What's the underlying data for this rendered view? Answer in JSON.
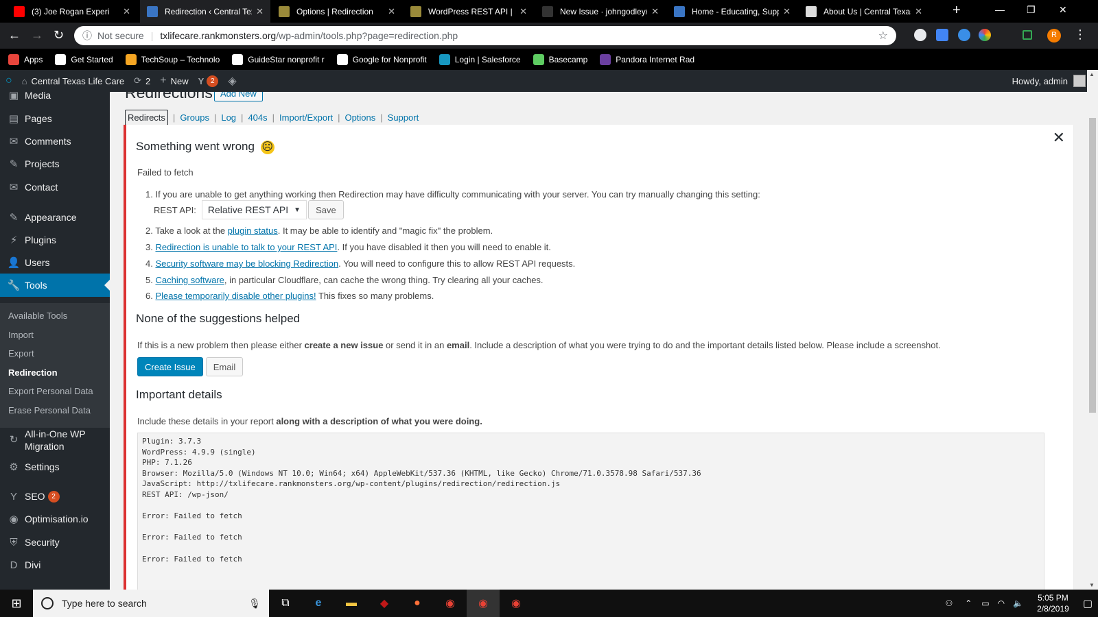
{
  "browser": {
    "tabs": [
      {
        "title": "(3) Joe Rogan Experi",
        "favicon": "youtube-icon",
        "color": "#ff0000"
      },
      {
        "title": "Redirection ‹ Central Tex",
        "favicon": "wp-site-icon",
        "color": "#3a75c4",
        "active": true
      },
      {
        "title": "Options | Redirection",
        "favicon": "plugin-icon",
        "color": "#9a8a3a"
      },
      {
        "title": "WordPress REST API | Re",
        "favicon": "plugin-icon",
        "color": "#9a8a3a"
      },
      {
        "title": "New Issue · johngodley/",
        "favicon": "github-icon",
        "color": "#333333"
      },
      {
        "title": "Home - Educating, Supp",
        "favicon": "wp-site-icon",
        "color": "#3a75c4"
      },
      {
        "title": "About Us | Central Texas",
        "favicon": "page-icon",
        "color": "#dddddd"
      }
    ],
    "url": {
      "security": "Not secure",
      "host": "txlifecare.rankmonsters.org",
      "path": "/wp-admin/tools.php?page=redirection.php"
    },
    "bookmarks": [
      {
        "label": "Apps",
        "icon": "apps-icon",
        "color": "#e8453c"
      },
      {
        "label": "Get Started",
        "icon": "google-icon",
        "color": "#ffffff"
      },
      {
        "label": "TechSoup – Technolo",
        "icon": "techsoup-icon",
        "color": "#f5a623"
      },
      {
        "label": "GuideStar nonprofit r",
        "icon": "guidestar-icon",
        "color": "#ffffff"
      },
      {
        "label": "Google for Nonprofit",
        "icon": "google-icon",
        "color": "#ffffff"
      },
      {
        "label": "Login | Salesforce",
        "icon": "salesforce-icon",
        "color": "#1798c1"
      },
      {
        "label": "Basecamp",
        "icon": "basecamp-icon",
        "color": "#5ecc62"
      },
      {
        "label": "Pandora Internet Rad",
        "icon": "pandora-icon",
        "color": "#6b3fa0"
      }
    ],
    "profile_initial": "R"
  },
  "adminbar": {
    "site_name": "Central Texas Life Care",
    "updates_count": "2",
    "new_label": "New",
    "seo_badge": "2",
    "howdy": "Howdy, admin"
  },
  "sidebar": {
    "items": [
      {
        "label": "Media",
        "icon": "media-icon",
        "top": 0
      },
      {
        "label": "Pages",
        "icon": "pages-icon"
      },
      {
        "label": "Comments",
        "icon": "comments-icon"
      },
      {
        "label": "Projects",
        "icon": "projects-icon"
      },
      {
        "label": "Contact",
        "icon": "contact-icon"
      },
      {
        "label": "Appearance",
        "icon": "appearance-icon"
      },
      {
        "label": "Plugins",
        "icon": "plugins-icon"
      },
      {
        "label": "Users",
        "icon": "users-icon"
      },
      {
        "label": "Tools",
        "icon": "tools-icon",
        "current": true
      },
      {
        "label": "All-in-One WP Migration",
        "icon": "migration-icon"
      },
      {
        "label": "Settings",
        "icon": "settings-icon"
      },
      {
        "label": "SEO",
        "icon": "seo-icon",
        "badge": "2"
      },
      {
        "label": "Optimisation.io",
        "icon": "optimisation-icon"
      },
      {
        "label": "Security",
        "icon": "security-icon"
      },
      {
        "label": "Divi",
        "icon": "divi-icon"
      }
    ],
    "submenu": [
      {
        "label": "Available Tools"
      },
      {
        "label": "Import"
      },
      {
        "label": "Export"
      },
      {
        "label": "Redirection",
        "active": true
      },
      {
        "label": "Export Personal Data"
      },
      {
        "label": "Erase Personal Data"
      }
    ]
  },
  "page": {
    "title": "Redirections",
    "add_new": "Add New",
    "tabs": [
      "Redirects",
      "Groups",
      "Log",
      "404s",
      "Import/Export",
      "Options",
      "Support"
    ]
  },
  "error": {
    "heading": "Something went wrong",
    "emoji": "☹",
    "message": "Failed to fetch",
    "steps": [
      {
        "pre": "",
        "link": "",
        "post": "If you are unable to get anything working then Redirection may have difficulty communicating with your server. You can try manually changing this setting:"
      },
      {
        "pre": "Take a look at the ",
        "link": "plugin status",
        "post": ". It may be able to identify and \"magic fix\" the problem."
      },
      {
        "pre": "",
        "link": "Redirection is unable to talk to your REST API",
        "post": ". If you have disabled it then you will need to enable it."
      },
      {
        "pre": "",
        "link": "Security software may be blocking Redirection",
        "post": ". You will need to configure this to allow REST API requests."
      },
      {
        "pre": "",
        "link": "Caching software",
        "post": ", in particular Cloudflare, can cache the wrong thing. Try clearing all your caches."
      },
      {
        "pre": "",
        "link": "Please temporarily disable other plugins!",
        "post": " This fixes so many problems."
      }
    ],
    "rest_label": "REST API:",
    "rest_value": "Relative REST API",
    "save_label": "Save",
    "none_helped": "None of the suggestions helped",
    "help_text_a": "If this is a new problem then please either ",
    "help_bold_a": "create a new issue",
    "help_text_b": " or send it in an ",
    "help_bold_b": "email",
    "help_text_c": ". Include a description of what you were trying to do and the important details listed below. Please include a screenshot.",
    "create_issue": "Create Issue",
    "email": "Email",
    "details_heading": "Important details",
    "details_text": "Include these details in your report ",
    "details_bold": "along with a description of what you were doing.",
    "details_pre": "Plugin: 3.7.3\nWordPress: 4.9.9 (single)\nPHP: 7.1.26\nBrowser: Mozilla/5.0 (Windows NT 10.0; Win64; x64) AppleWebKit/537.36 (KHTML, like Gecko) Chrome/71.0.3578.98 Safari/537.36\nJavaScript: http://txlifecare.rankmonsters.org/wp-content/plugins/redirection/redirection.js\nREST API: /wp-json/\n\nError: Failed to fetch\n\nError: Failed to fetch\n\nError: Failed to fetch"
  },
  "taskbar": {
    "search_placeholder": "Type here to search",
    "time": "5:05 PM",
    "date": "2/8/2019"
  }
}
